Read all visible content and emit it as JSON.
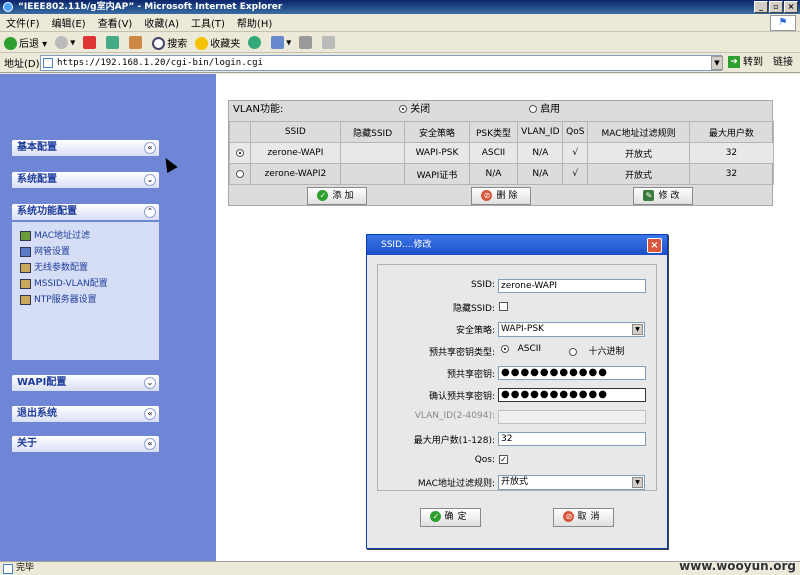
{
  "window": {
    "title": "“IEEE802.11b/g室内AP” - Microsoft Internet Explorer",
    "controls": [
      "_",
      "▫",
      "×"
    ]
  },
  "menubar": [
    "文件(F)",
    "编辑(E)",
    "查看(V)",
    "收藏(A)",
    "工具(T)",
    "帮助(H)"
  ],
  "toolbar": {
    "back": "后退",
    "search": "搜索",
    "favorites": "收藏夹"
  },
  "addressbar": {
    "label": "地址(D)",
    "url": "https://192.168.1.20/cgi-bin/login.cgi",
    "go": "转到",
    "links": "链接"
  },
  "sidebar": {
    "basic": "基本配置",
    "system": "系统配置",
    "function": "系统功能配置",
    "function_items": [
      "MAC地址过滤",
      "网管设置",
      "无线参数配置",
      "MSSID-VLAN配置",
      "NTP服务器设置"
    ],
    "wapi": "WAPI配置",
    "logout": "退出系统",
    "about": "关于",
    "toggle_collapsed": "«",
    "toggle_expanded_down": "»"
  },
  "vlan": {
    "label": "VLAN功能:",
    "off": "关闭",
    "on": "启用",
    "selected": "off"
  },
  "ssid_table": {
    "headers": [
      "",
      "SSID",
      "隐藏SSID",
      "安全策略",
      "PSK类型",
      "VLAN_ID",
      "QoS",
      "MAC地址过滤规则",
      "最大用户数"
    ],
    "rows": [
      {
        "selected": true,
        "ssid": "zerone-WAPI",
        "hidden": "",
        "policy": "WAPI-PSK",
        "psk": "ASCII",
        "vlan": "N/A",
        "qos": "√",
        "mac": "开放式",
        "max": "32"
      },
      {
        "selected": false,
        "ssid": "zerone-WAPI2",
        "hidden": "",
        "policy": "WAPI证书",
        "psk": "N/A",
        "vlan": "N/A",
        "qos": "√",
        "mac": "开放式",
        "max": "32"
      }
    ],
    "buttons": {
      "add": "添加",
      "delete": "删除",
      "modify": "修改"
    }
  },
  "dialog": {
    "title": "SSID....修改",
    "ssid_label": "SSID:",
    "ssid_value": "zerone-WAPI",
    "hidden_label": "隐藏SSID:",
    "policy_label": "安全策略:",
    "policy_value": "WAPI-PSK",
    "psk_type_label": "预共享密钥类型:",
    "psk_ascii": "ASCII",
    "psk_hex": "十六进制",
    "psk_label": "预共享密钥:",
    "psk_value": "●●●●●●●●●●●",
    "psk_confirm_label": "确认预共享密钥:",
    "psk_confirm_value": "●●●●●●●●●●●",
    "vlan_label": "VLAN_ID(2-4094):",
    "vlan_value": "",
    "max_users_label": "最大用户数(1-128):",
    "max_users_value": "32",
    "qos_label": "Qos:",
    "qos_check": "✓",
    "mac_label": "MAC地址过滤规则:",
    "mac_value": "开放式",
    "ok": "确定",
    "cancel": "取消"
  },
  "statusbar": {
    "text": "完毕",
    "watermark": "www.wooyun.org"
  }
}
